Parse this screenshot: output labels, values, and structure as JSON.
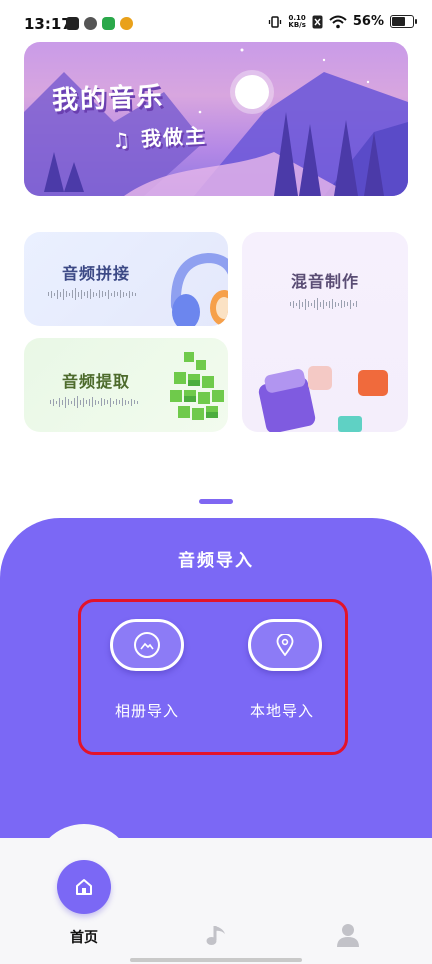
{
  "status_bar": {
    "time": "13:17",
    "net_speed_value": "0.10",
    "net_speed_unit": "KB/s",
    "battery": "56%"
  },
  "banner": {
    "title": "我的音乐",
    "subtitle": "♫ 我做主"
  },
  "features": {
    "splice": "音频拼接",
    "extract": "音频提取",
    "mix": "混音制作"
  },
  "import": {
    "title": "音频导入",
    "album_label": "相册导入",
    "local_label": "本地导入",
    "album_icon": "image-icon",
    "local_icon": "location-pin-icon"
  },
  "tabs": [
    {
      "label": "首页",
      "icon": "home-icon",
      "active": true
    },
    {
      "label": "",
      "icon": "music-note-icon",
      "active": false
    },
    {
      "label": "",
      "icon": "person-icon",
      "active": false
    }
  ],
  "colors": {
    "accent": "#7b68f5",
    "highlight_outline": "#e3132b"
  }
}
